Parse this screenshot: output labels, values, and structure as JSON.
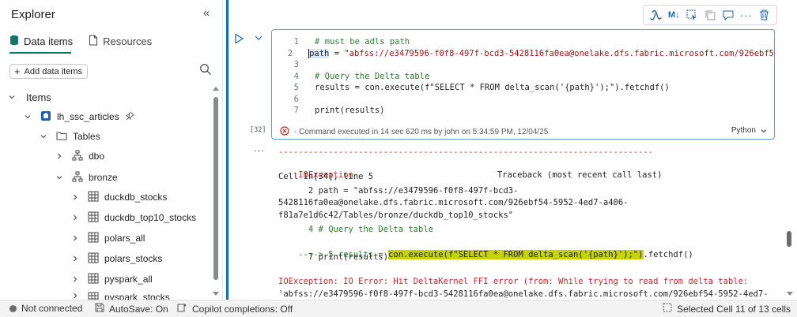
{
  "explorer": {
    "title": "Explorer",
    "collapse_icon": "double-chevron-left-icon",
    "tabs": [
      {
        "label": "Data items",
        "icon": "database-icon",
        "active": true
      },
      {
        "label": "Resources",
        "icon": "document-icon",
        "active": false
      }
    ],
    "add_button_label": "Add data items",
    "tree": {
      "items_label": "Items",
      "lakehouse": "lh_ssc_articles",
      "tables_label": "Tables",
      "schemas": [
        {
          "name": "dbo",
          "expanded": false
        },
        {
          "name": "bronze",
          "expanded": true
        }
      ],
      "tables": [
        "duckdb_stocks",
        "duckdb_top10_stocks",
        "polars_all",
        "polars_stocks",
        "pyspark_all",
        "pyspark_stocks"
      ]
    }
  },
  "notebook": {
    "toolbar_icons": [
      "copilot-icon",
      "markdown-icon",
      "select-icon",
      "copy-icon",
      "comment-icon",
      "more-icon",
      "delete-icon"
    ],
    "code_lines": [
      {
        "n": "1",
        "text": "# must be adls path"
      },
      {
        "n": "2",
        "text": "path = \"abfss://e3479596-f0f8-497f-bcd3-5428116fa0ea@onelake.dfs.fabric.microsoft.com/926ebf5"
      },
      {
        "n": "3",
        "text": ""
      },
      {
        "n": "4",
        "text": "# Query the Delta table"
      },
      {
        "n": "5",
        "text": "results = con.execute(f\"SELECT * FROM delta_scan('{path}');\").fetchdf()"
      },
      {
        "n": "6",
        "text": ""
      },
      {
        "n": "7",
        "text": "print(results)"
      }
    ],
    "exec_count": "[32]",
    "status": "- Command executed in 14 sec 620 ms by john on 5:34:59 PM, 12/04/25",
    "language": "Python",
    "output_dots": "...",
    "output": {
      "separator": "---------------------------------------------------------------------------",
      "exception": "IOException",
      "traceback": "Traceback (most recent call last)",
      "cell_ref": "Cell In[34], line 5",
      "l2a": "      2 path = \"abfss://e3479596-f0f8-497f-bcd3-",
      "l2b": "5428116fa0ea@onelake.dfs.fabric.microsoft.com/926ebf54-5952-4ed7-a406-",
      "l2c": "f81a7e1d6c42/Tables/bronze/duckdb_top10_stocks\"",
      "l4": "      4 # Query the Delta table",
      "l5_prefix": "----> 5 results = ",
      "l5_hl": "con.execute(f\"SELECT * FROM delta_scan('{path}');\")",
      "l5_suffix": ".fetchdf()",
      "l7": "      7 print(results)",
      "err1": "IOException: IO Error: Hit DeltaKernel FFI error (from: While trying to read from delta table:",
      "err2": "'abfss://e3479596-f0f8-497f-bcd3-5428116fa0ea@onelake.dfs.fabric.microsoft.com/926ebf54-5952-4ed7-"
    }
  },
  "statusbar": {
    "connection": "Not connected",
    "autosave": "AutoSave: On",
    "copilot": "Copilot completions: Off",
    "selection": "Selected Cell 11 of 13 cells"
  }
}
